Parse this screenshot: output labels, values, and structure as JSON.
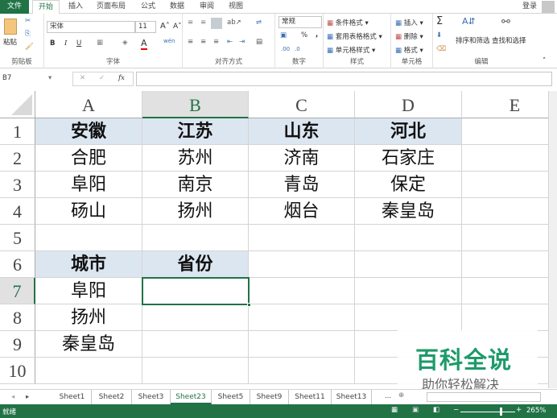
{
  "ribbon_tabs": [
    "文件",
    "开始",
    "插入",
    "页面布局",
    "公式",
    "数据",
    "审阅",
    "视图"
  ],
  "login": "登录",
  "clipboard": {
    "paste": "粘贴",
    "label": "剪贴板"
  },
  "font": {
    "name": "宋体",
    "size": "11",
    "bold": "B",
    "italic": "I",
    "underline": "U",
    "label": "字体"
  },
  "alignment": {
    "label": "对齐方式"
  },
  "number": {
    "format": "常规",
    "percent": "%",
    "comma": ",",
    "label": "数字"
  },
  "styles": {
    "items": [
      "条件格式",
      "套用表格格式",
      "单元格样式"
    ],
    "label": "样式"
  },
  "cells": {
    "items": [
      "插入",
      "删除",
      "格式"
    ],
    "label": "单元格"
  },
  "editing": {
    "sort": "排序和筛选",
    "find": "查找和选择",
    "label": "编辑"
  },
  "formula_bar": {
    "name_box": "B7",
    "fx": "fx",
    "value": ""
  },
  "columns": [
    "A",
    "B",
    "C",
    "D",
    "E"
  ],
  "rows": [
    "1",
    "2",
    "3",
    "4",
    "5",
    "6",
    "7",
    "8",
    "9",
    "10"
  ],
  "grid": [
    [
      "安徽",
      "江苏",
      "山东",
      "河北",
      ""
    ],
    [
      "合肥",
      "苏州",
      "济南",
      "石家庄",
      ""
    ],
    [
      "阜阳",
      "南京",
      "青岛",
      "保定",
      ""
    ],
    [
      "砀山",
      "扬州",
      "烟台",
      "秦皇岛",
      ""
    ],
    [
      "",
      "",
      "",
      "",
      ""
    ],
    [
      "城市",
      "省份",
      "",
      "",
      ""
    ],
    [
      "阜阳",
      "",
      "",
      "",
      ""
    ],
    [
      "扬州",
      "",
      "",
      "",
      ""
    ],
    [
      "秦皇岛",
      "",
      "",
      "",
      ""
    ],
    [
      "",
      "",
      "",
      "",
      ""
    ]
  ],
  "selected_cell": "B7",
  "sheet_tabs": [
    "Sheet1",
    "Sheet2",
    "Sheet3",
    "Sheet23",
    "Sheet5",
    "Sheet9",
    "Sheet11",
    "Sheet13"
  ],
  "active_sheet": "Sheet23",
  "more_sheets": "...",
  "status": {
    "ready": "就绪",
    "zoom": "265%"
  },
  "watermark": {
    "title": "百科全说",
    "subtitle": "助你轻松解决"
  },
  "colors": {
    "accent": "#217346",
    "header_fill": "#dce6f1"
  }
}
